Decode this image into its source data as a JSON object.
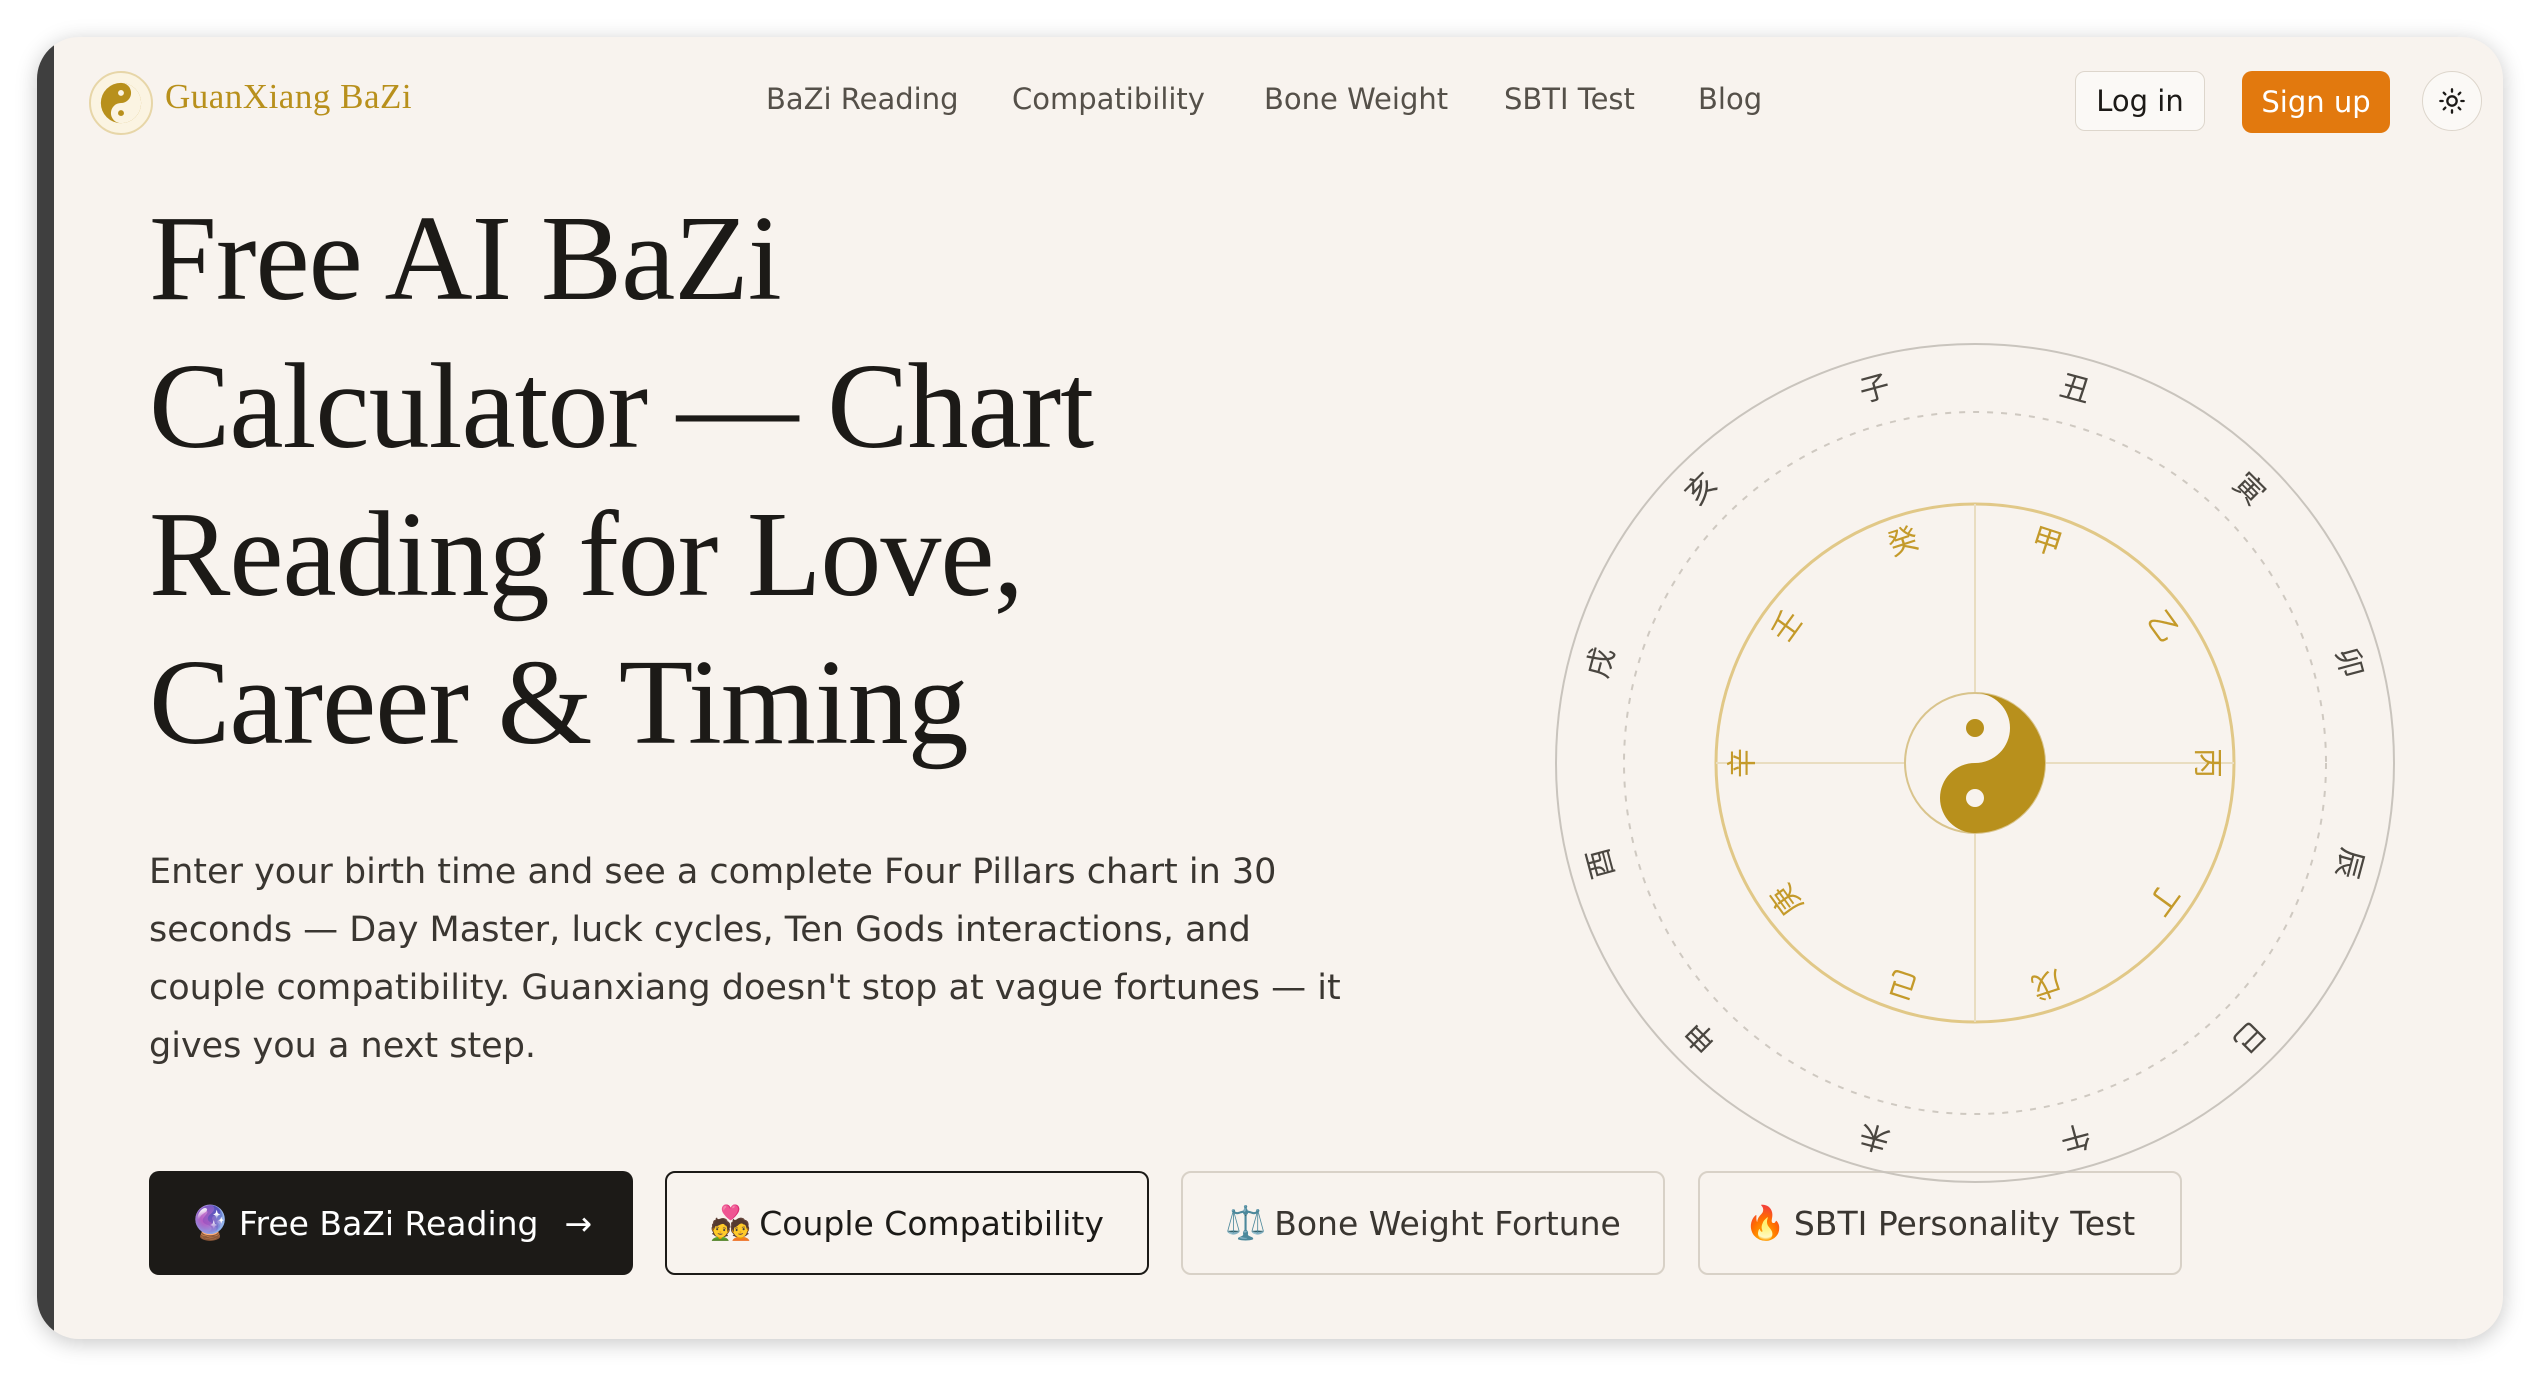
{
  "header": {
    "brand": "GuanXiang BaZi",
    "nav": [
      "BaZi Reading",
      "Compatibility",
      "Bone Weight",
      "SBTI Test",
      "Blog"
    ],
    "login_label": "Log in",
    "signup_label": "Sign up"
  },
  "hero": {
    "title_lines": [
      "Free AI BaZi",
      "Calculator — Chart",
      "Reading for Love,",
      "Career & Timing"
    ],
    "description": "Enter your birth time and see a complete Four Pillars chart in 30 seconds — Day Master, luck cycles, Ten Gods interactions, and couple compatibility. Guanxiang doesn't stop at vague fortunes — it gives you a next step."
  },
  "cta": {
    "primary": {
      "icon": "🔮",
      "label": "Free BaZi Reading",
      "arrow": "→"
    },
    "couple": {
      "icon": "💑",
      "label": "Couple Compatibility"
    },
    "bone": {
      "icon": "⚖️",
      "label": "Bone Weight Fortune"
    },
    "sbti": {
      "icon": "🔥",
      "label": "SBTI Personality Test"
    }
  },
  "wheel": {
    "branches": [
      "子",
      "丑",
      "寅",
      "卯",
      "辰",
      "巳",
      "午",
      "未",
      "申",
      "酉",
      "戌",
      "亥"
    ],
    "stems": [
      "甲",
      "乙",
      "丙",
      "丁",
      "戊",
      "己",
      "庚",
      "辛",
      "壬",
      "癸"
    ]
  },
  "colors": {
    "background": "#f8f3ee",
    "gold": "#b8901c",
    "accent_orange": "#e2790e",
    "dark": "#1c1a17"
  },
  "icons": {
    "logo": "yin-yang-icon",
    "theme_toggle": "sun-icon",
    "wheel_center": "yin-yang-icon"
  }
}
